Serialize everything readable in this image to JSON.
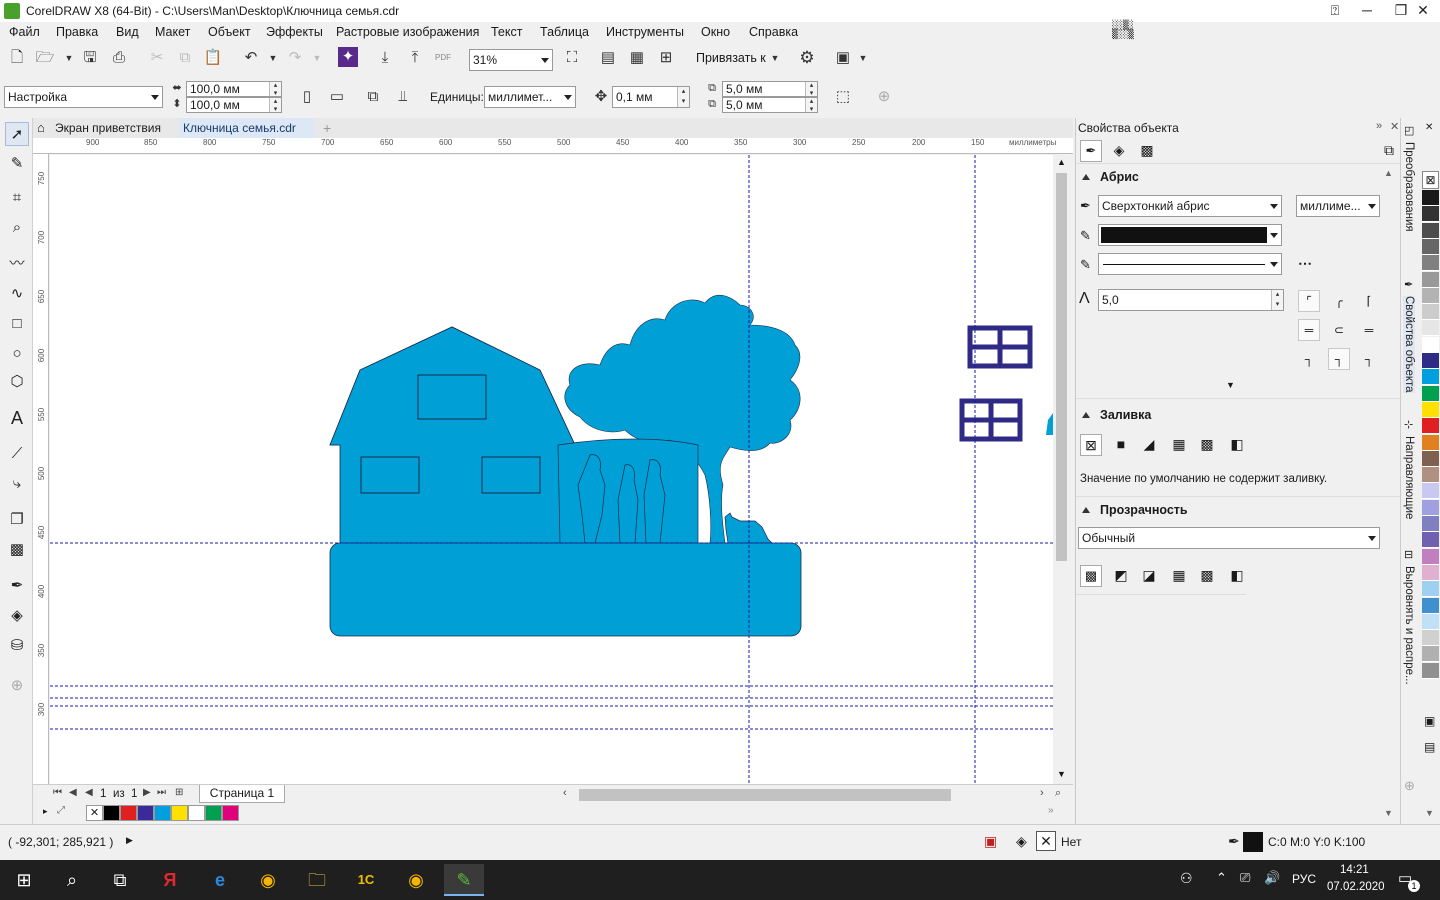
{
  "window": {
    "title": "CorelDRAW X8 (64-Bit) - C:\\Users\\Man\\Desktop\\Ключница семья.cdr"
  },
  "menu": [
    "Файл",
    "Правка",
    "Вид",
    "Макет",
    "Объект",
    "Эффекты",
    "Растровые изображения",
    "Текст",
    "Таблица",
    "Инструменты",
    "Окно",
    "Справка"
  ],
  "toolbar1": {
    "zoom": "31%",
    "snap_label": "Привязать к"
  },
  "toolbar2": {
    "preset": "Настройка",
    "width": "100,0 мм",
    "height": "100,0 мм",
    "units_label": "Единицы:",
    "units_value": "миллимет...",
    "nudge": "0,1 мм",
    "dup_x": "5,0 мм",
    "dup_y": "5,0 мм"
  },
  "doc_tabs": [
    "Экран приветствия",
    "Ключница семья.cdr"
  ],
  "ruler_top": [
    "900",
    "850",
    "800",
    "750",
    "700",
    "650",
    "600",
    "550",
    "500",
    "450",
    "400",
    "350",
    "300",
    "250",
    "200",
    "150",
    "миллиметры"
  ],
  "ruler_left": [
    "750",
    "700",
    "650",
    "600",
    "550",
    "500",
    "450",
    "400",
    "350",
    "300"
  ],
  "page_nav": {
    "current": "1",
    "of": "из",
    "total": "1",
    "page_tab": "Страница 1"
  },
  "status": {
    "coords": "( -92,301; 285,921 )",
    "fill_label": "Нет",
    "outline_label": "C:0 M:0 Y:0 K:100"
  },
  "docker": {
    "title": "Свойства объекта",
    "outline_section": "Абрис",
    "outline_width": "Сверхтонкий абрис",
    "outline_units": "миллиме...",
    "miter": "5,0",
    "fill_section": "Заливка",
    "fill_text": "Значение по умолчанию не содержит заливку.",
    "transparency_section": "Прозрачность",
    "transparency_mode": "Обычный"
  },
  "side_tabs": [
    "Преобразования",
    "Свойства объекта",
    "Направляющие",
    "Выровнять и распре..."
  ],
  "taskbar": {
    "lang": "РУС",
    "time": "14:21",
    "date": "07.02.2020",
    "notif_count": "1"
  },
  "colors": {
    "object_fill": "#00a0d6",
    "window_stroke": "#2e2a85",
    "guide": "#1a1aa8"
  },
  "palette_bottom": [
    "#ffffff",
    "#000000",
    "#e02020",
    "#3a2a9a",
    "#00a0e0",
    "#ffe000",
    "#ffffff",
    "#00a050",
    "#e0007a"
  ],
  "palette_right": [
    "#1a1a1a",
    "#333333",
    "#4d4d4d",
    "#666666",
    "#808080",
    "#999999",
    "#b3b3b3",
    "#cccccc",
    "#e6e6e6",
    "#ffffff",
    "#2e2a85",
    "#00a0e0",
    "#00a050",
    "#ffe000",
    "#e02020",
    "#e08020",
    "#806050",
    "#b09080",
    "#c8c8f0",
    "#a0a0e0",
    "#8080c0",
    "#7060b0",
    "#c080c0",
    "#e0b0d0",
    "#a0d0f0",
    "#4090d0",
    "#c0e0f8",
    "#d0d0d0",
    "#b0b0b0",
    "#909090"
  ]
}
